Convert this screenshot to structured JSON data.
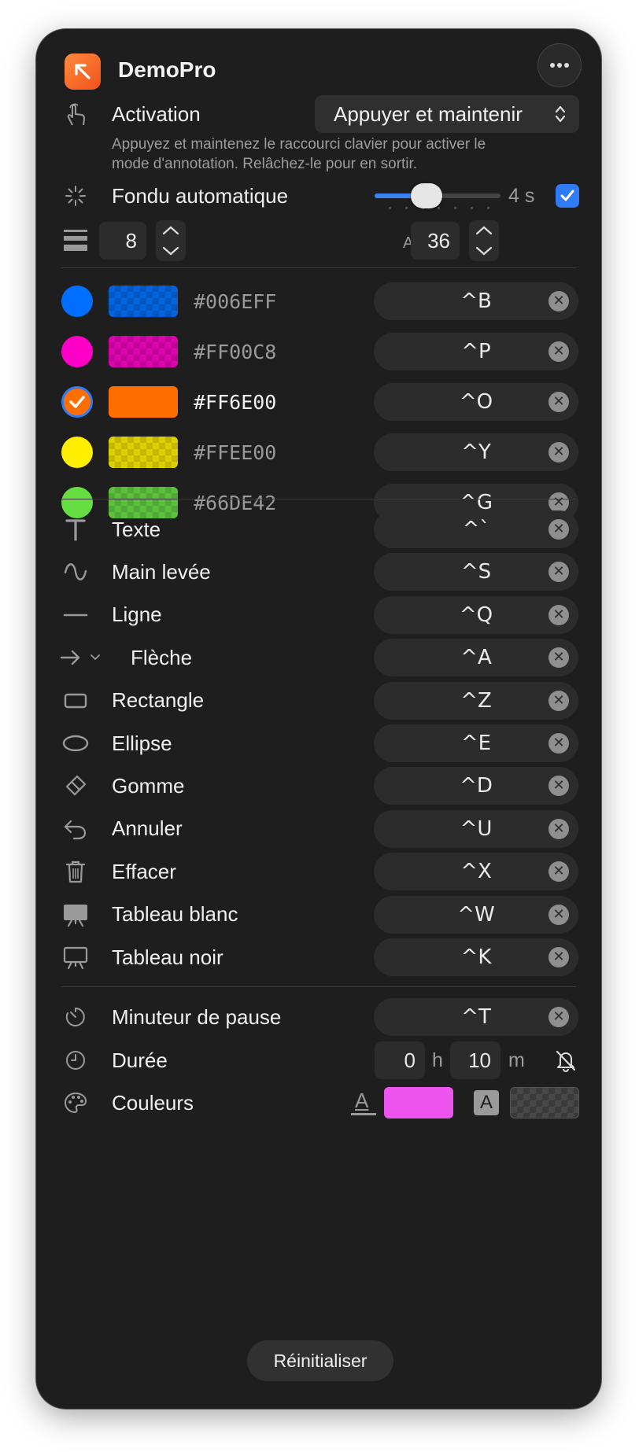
{
  "app": {
    "title": "DemoPro",
    "more_icon": "ellipsis-icon"
  },
  "activation": {
    "label": "Activation",
    "value": "Appuyer et maintenir",
    "description_line1": "Appuyez et maintenez le raccourci clavier pour activer le",
    "description_line2": "mode d'annotation. Relâchez-le pour en sortir."
  },
  "fade": {
    "label": "Fondu automatique",
    "value": "4 s",
    "slider_fraction": 0.42,
    "enabled": true
  },
  "line_width": {
    "value": "8"
  },
  "font_size": {
    "icon_text": "AA",
    "value": "36"
  },
  "colors": [
    {
      "hex": "#006EFF",
      "shortcut": "^B",
      "selected": false
    },
    {
      "hex": "#FF00C8",
      "shortcut": "^P",
      "selected": false
    },
    {
      "hex": "#FF6E00",
      "shortcut": "^O",
      "selected": true
    },
    {
      "hex": "#FFEE00",
      "shortcut": "^Y",
      "selected": false
    },
    {
      "hex": "#66DE42",
      "shortcut": "^G",
      "selected": false
    }
  ],
  "tools": [
    {
      "label": "Texte",
      "shortcut": "^`",
      "icon": "text-icon"
    },
    {
      "label": "Main levée",
      "shortcut": "^S",
      "icon": "freehand-icon"
    },
    {
      "label": "Ligne",
      "shortcut": "^Q",
      "icon": "line-icon"
    },
    {
      "label": "Flèche",
      "shortcut": "^A",
      "icon": "arrow-icon"
    },
    {
      "label": "Rectangle",
      "shortcut": "^Z",
      "icon": "rectangle-icon"
    },
    {
      "label": "Ellipse",
      "shortcut": "^E",
      "icon": "ellipse-icon"
    },
    {
      "label": "Gomme",
      "shortcut": "^D",
      "icon": "eraser-icon"
    },
    {
      "label": "Annuler",
      "shortcut": "^U",
      "icon": "undo-icon"
    },
    {
      "label": "Effacer",
      "shortcut": "^X",
      "icon": "trash-icon"
    },
    {
      "label": "Tableau blanc",
      "shortcut": "^W",
      "icon": "whiteboard-icon"
    },
    {
      "label": "Tableau noir",
      "shortcut": "^K",
      "icon": "blackboard-icon"
    }
  ],
  "timer": {
    "label": "Minuteur de pause",
    "shortcut": "^T",
    "duration_label": "Durée",
    "hours": "0",
    "hours_unit": "h",
    "minutes": "10",
    "minutes_unit": "m",
    "colors_label": "Couleurs",
    "text_icon_letter": "A",
    "bg_icon_letter": "A",
    "text_color": "#EE55EE"
  },
  "reset_label": "Réinitialiser",
  "clear_glyph": "✕"
}
